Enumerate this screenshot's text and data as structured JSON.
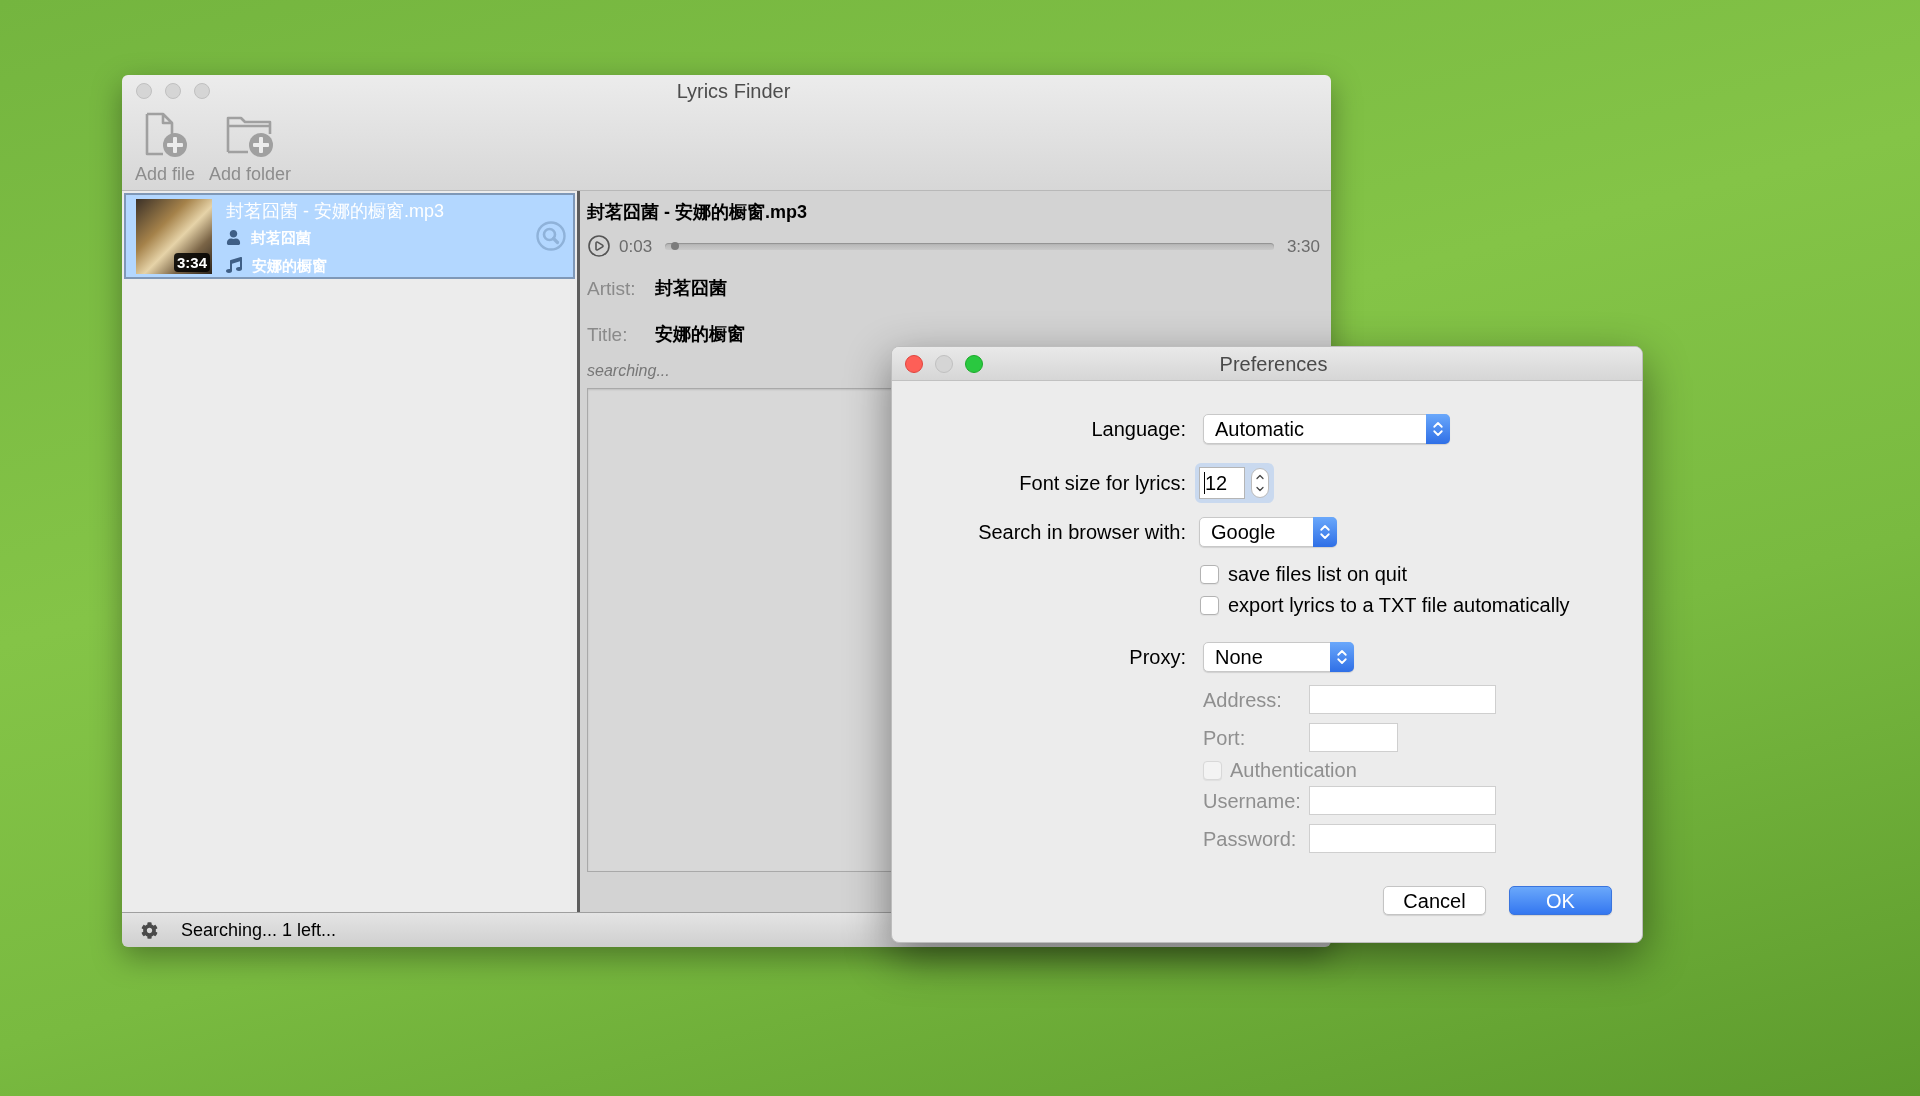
{
  "main_window": {
    "title": "Lyrics Finder",
    "active": false,
    "toolbar": [
      {
        "kind": "file",
        "label": "Add file"
      },
      {
        "kind": "folder",
        "label": "Add folder"
      }
    ],
    "file_list": [
      {
        "title": "封茗囧菌 - 安娜的橱窗.mp3",
        "artist": "封茗囧菌",
        "song": "安娜的橱窗",
        "duration": "3:34",
        "selected": true
      }
    ],
    "details": {
      "title": "封茗囧菌 - 安娜的橱窗.mp3",
      "player": {
        "elapsed": "0:03",
        "total": "3:30",
        "level": 0.01
      },
      "fields": [
        {
          "label": "Artist:",
          "value": "封茗囧菌"
        },
        {
          "label": "Title:",
          "value": "安娜的橱窗"
        }
      ],
      "status": "searching..."
    },
    "status_bar": {
      "text": "Searching... 1 left..."
    }
  },
  "preferences": {
    "title": "Preferences",
    "active": true,
    "minimizable": false,
    "language": {
      "label": "Language:",
      "value": "Automatic"
    },
    "font_size": {
      "label": "Font size for lyrics:",
      "value": "12",
      "focused": true
    },
    "browser": {
      "label": "Search in browser with:",
      "value": "Google"
    },
    "options": [
      {
        "label": "save files list on quit",
        "checked": false
      },
      {
        "label": "export lyrics to a TXT file automatically",
        "checked": false
      }
    ],
    "proxy": {
      "label": "Proxy:",
      "value": "None"
    },
    "proxy_fields": [
      {
        "kind": "text",
        "label": "Address:",
        "disabled": true
      },
      {
        "kind": "number",
        "label": "Port:",
        "disabled": true
      },
      {
        "kind": "checkbox",
        "label": "Authentication",
        "checked": false,
        "disabled": true
      },
      {
        "kind": "text",
        "label": "Username:",
        "disabled": true
      },
      {
        "kind": "password",
        "label": "Password:",
        "disabled": true
      }
    ],
    "buttons": [
      {
        "kind": "secondary",
        "label": "Cancel"
      },
      {
        "kind": "primary",
        "label": "OK"
      }
    ]
  }
}
